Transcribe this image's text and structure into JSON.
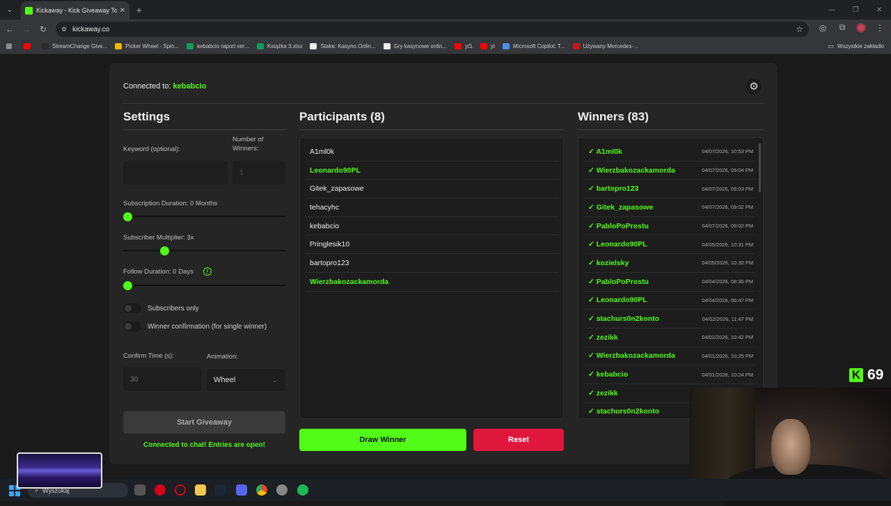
{
  "browser": {
    "tab_title": "Kickaway - Kick Giveaway Tool",
    "url": "kickaway.co",
    "bookmarks": [
      {
        "label": "",
        "color": "#ff0000"
      },
      {
        "label": "StreamChange Give...",
        "color": "#2a2a2a"
      },
      {
        "label": "Picker Wheel - Spin...",
        "color": "#f4b400"
      },
      {
        "label": "kebabcio raport ver...",
        "color": "#0f9d58"
      },
      {
        "label": "Książka 3.xlsx",
        "color": "#0f9d58"
      },
      {
        "label": "Stake: Kasyno Onlin...",
        "color": "#eeeeee"
      },
      {
        "label": "Gry kasynowe onlin...",
        "color": "#eeeeee"
      },
      {
        "label": "yt1",
        "color": "#ff0000"
      },
      {
        "label": "yt",
        "color": "#ff0000"
      },
      {
        "label": "Microsoft Copilot: T...",
        "color": "#4a90e2"
      },
      {
        "label": "Używany Mercedes-...",
        "color": "#c4161c"
      }
    ],
    "all_bookmarks_label": "Wszystkie zakładki"
  },
  "app": {
    "connected_prefix": "Connected to:",
    "connected_channel": "kebabcio",
    "settings": {
      "title": "Settings",
      "keyword_label": "Keyword (optional):",
      "winners_label": "Number of Winners:",
      "winners_value": "1",
      "sub_duration_label": "Subscription Duration: 0 Months",
      "sub_duration_value": 0,
      "sub_multiplier_label": "Subscriber Multiplier: 3x",
      "sub_multiplier_value": 0.24,
      "follow_duration_label": "Follow Duration:  0  Days",
      "follow_duration_value": 0,
      "subscribers_only_label": "Subscribers only",
      "winner_confirmation_label": "Winner confirmation (for single winner)",
      "confirm_time_label": "Confirm Time (s):",
      "confirm_time_placeholder": "30",
      "animation_label": "Animation:",
      "animation_value": "Wheel",
      "start_button": "Start Giveaway",
      "status_text": "Connected to chat! Entries are open!"
    },
    "participants": {
      "title": "Participants (8)",
      "items": [
        {
          "name": "A1ml0k",
          "highlight": false
        },
        {
          "name": "Leonardo90PL",
          "highlight": true
        },
        {
          "name": "Gitek_zapasowe",
          "highlight": false
        },
        {
          "name": "tehacyhc",
          "highlight": false
        },
        {
          "name": "kebabcio",
          "highlight": false
        },
        {
          "name": "Pringlesik10",
          "highlight": false
        },
        {
          "name": "bartopro123",
          "highlight": false
        },
        {
          "name": "Wierzbakozackamorda",
          "highlight": true
        }
      ]
    },
    "winners": {
      "title": "Winners (83)",
      "items": [
        {
          "name": "✓ A1ml0k",
          "date": "04/07/2026, 10:53 PM"
        },
        {
          "name": "✓ Wierzbakozackamorda",
          "date": "04/07/2026, 09:04 PM"
        },
        {
          "name": "✓ bartopro123",
          "date": "04/07/2026, 09:03 PM"
        },
        {
          "name": "✓ Gitek_zapasowe",
          "date": "04/07/2026, 09:02 PM"
        },
        {
          "name": "✓ PabloPoProstu",
          "date": "04/07/2026, 09:02 PM"
        },
        {
          "name": "✓ Leonardo90PL",
          "date": "04/05/2026, 10:31 PM"
        },
        {
          "name": "✓ kozielsky",
          "date": "04/05/2026, 10:30 PM"
        },
        {
          "name": "✓ PabloPoProstu",
          "date": "04/04/2026, 08:30 PM"
        },
        {
          "name": "✓ Leonardo90PL",
          "date": "04/04/2026, 06:47 PM"
        },
        {
          "name": "✓ stachurs0n2konto",
          "date": "04/02/2026, 11:47 PM"
        },
        {
          "name": "✓ zezikk",
          "date": "04/02/2026, 10:42 PM"
        },
        {
          "name": "✓ Wierzbakozackamorda",
          "date": "04/01/2026, 10:25 PM"
        },
        {
          "name": "✓ kebabcio",
          "date": "04/01/2026, 10:24 PM"
        },
        {
          "name": "✓ zezikk",
          "date": ""
        },
        {
          "name": "✓ stachurs0n2konto",
          "date": ""
        }
      ]
    },
    "draw_button": "Draw Winner",
    "reset_button": "Reset"
  },
  "overlay": {
    "viewer_count": "69"
  },
  "taskbar": {
    "search_placeholder": "Wyszukaj"
  },
  "colors": {
    "accent": "#53fc18",
    "danger": "#e0173d",
    "bg": "#1a1a1a",
    "card": "#252525"
  }
}
